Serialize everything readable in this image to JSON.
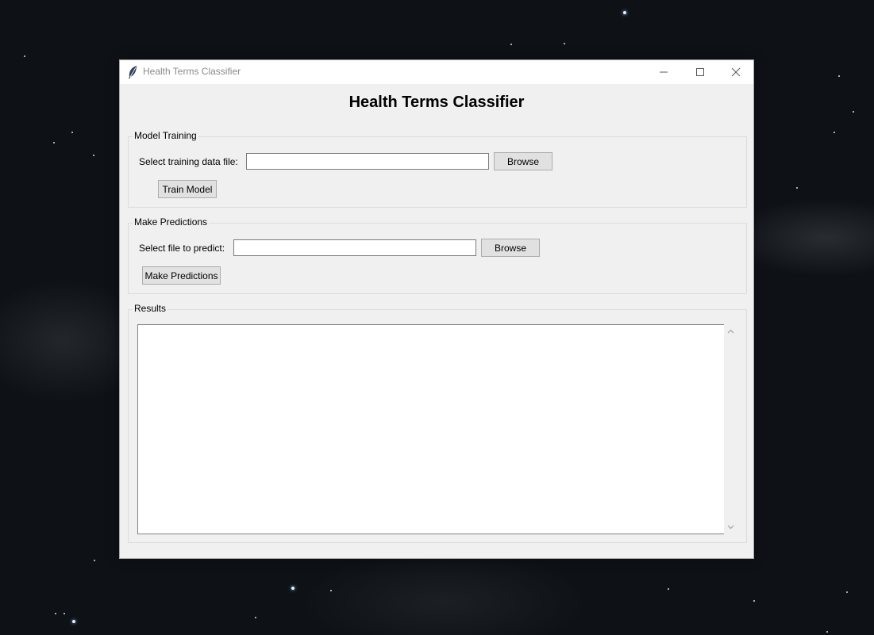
{
  "window": {
    "title": "Health Terms Classifier",
    "icon": "feather-icon",
    "controls": [
      "minimize-icon",
      "maximize-icon",
      "close-icon"
    ]
  },
  "app": {
    "heading": "Health Terms Classifier"
  },
  "training": {
    "group_label": "Model Training",
    "file_label": "Select training data file:",
    "file_value": "",
    "browse_label": "Browse",
    "train_label": "Train Model"
  },
  "predictions": {
    "group_label": "Make Predictions",
    "file_label": "Select file to predict:",
    "file_value": "",
    "browse_label": "Browse",
    "predict_label": "Make Predictions"
  },
  "results": {
    "group_label": "Results",
    "text": ""
  }
}
